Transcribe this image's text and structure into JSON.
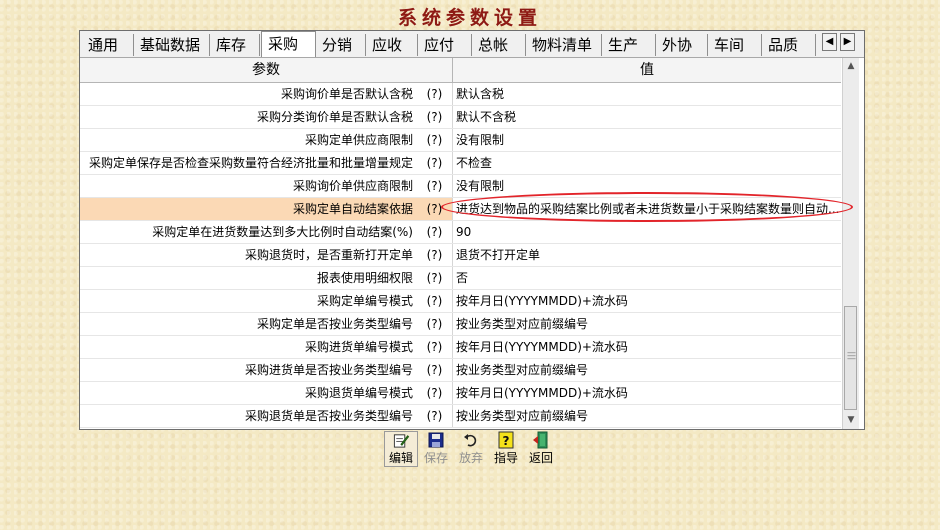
{
  "window_title": "系统参数设置",
  "tabs": [
    "通用",
    "基础数据",
    "库存",
    "采购",
    "分销",
    "应收",
    "应付",
    "总帐",
    "物料清单",
    "生产",
    "外协",
    "车间",
    "品质"
  ],
  "active_tab": "采购",
  "tab_scroll": {
    "left": "◀",
    "right": "▶"
  },
  "table": {
    "headers": {
      "param": "参数",
      "value": "值"
    },
    "rows": [
      {
        "param": "采购询价单是否默认含税",
        "help": "(?)",
        "value": "默认含税"
      },
      {
        "param": "采购分类询价单是否默认含税",
        "help": "(?)",
        "value": "默认不含税"
      },
      {
        "param": "采购定单供应商限制",
        "help": "(?)",
        "value": "没有限制"
      },
      {
        "param": "采购定单保存是否检查采购数量符合经济批量和批量增量规定",
        "help": "(?)",
        "value": "不检查"
      },
      {
        "param": "采购询价单供应商限制",
        "help": "(?)",
        "value": "没有限制"
      },
      {
        "param": "采购定单自动结案依据",
        "help": "(?)",
        "value": "进货达到物品的采购结案比例或者未进货数量小于采购结案数量则自动..."
      },
      {
        "param": "采购定单在进货数量达到多大比例时自动结案(%)",
        "help": "(?)",
        "value": "90"
      },
      {
        "param": "采购退货时，是否重新打开定单",
        "help": "(?)",
        "value": "退货不打开定单"
      },
      {
        "param": "报表使用明细权限",
        "help": "(?)",
        "value": "否"
      },
      {
        "param": "采购定单编号模式",
        "help": "(?)",
        "value": "按年月日(YYYYMMDD)+流水码"
      },
      {
        "param": "采购定单是否按业务类型编号",
        "help": "(?)",
        "value": "按业务类型对应前缀编号"
      },
      {
        "param": "采购进货单编号模式",
        "help": "(?)",
        "value": "按年月日(YYYYMMDD)+流水码"
      },
      {
        "param": "采购进货单是否按业务类型编号",
        "help": "(?)",
        "value": "按业务类型对应前缀编号"
      },
      {
        "param": "采购退货单编号模式",
        "help": "(?)",
        "value": "按年月日(YYYYMMDD)+流水码"
      },
      {
        "param": "采购退货单是否按业务类型编号",
        "help": "(?)",
        "value": "按业务类型对应前缀编号"
      }
    ]
  },
  "selected_row_index": 5,
  "toolbar": {
    "edit": {
      "label": "编辑",
      "icon": "edit-icon"
    },
    "save": {
      "label": "保存",
      "icon": "save-icon",
      "disabled": true
    },
    "discard": {
      "label": "放弃",
      "icon": "undo-icon",
      "disabled": true
    },
    "guide": {
      "label": "指导",
      "icon": "help-icon"
    },
    "back": {
      "label": "返回",
      "icon": "exit-icon"
    }
  },
  "colors": {
    "background": "#f4e9c4",
    "title": "#8e1a14",
    "selected_row": "#fbd9b5",
    "annotation": "#e2242a"
  }
}
